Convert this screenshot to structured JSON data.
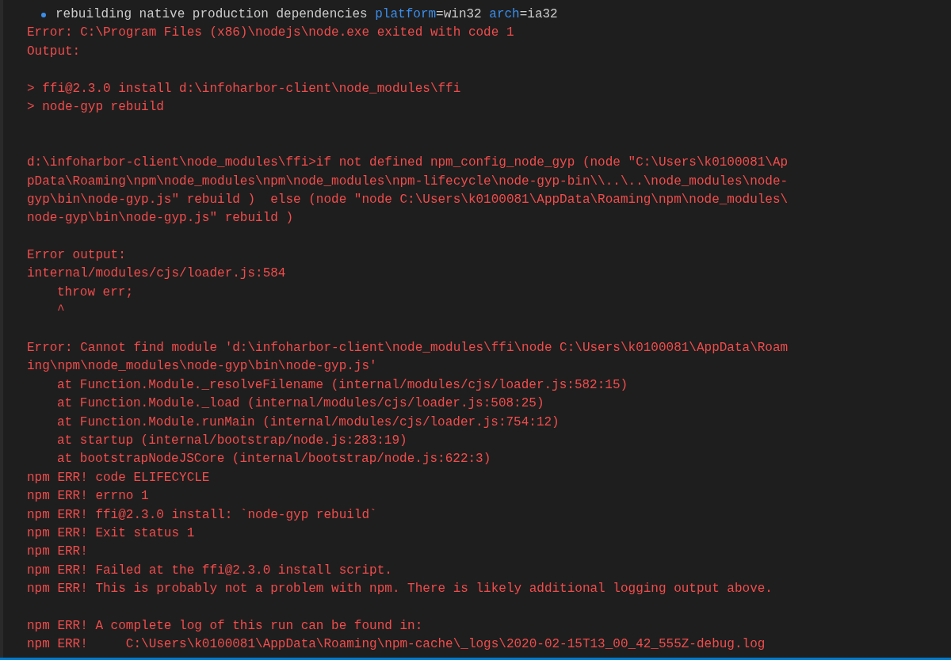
{
  "terminal": {
    "lines": [
      {
        "kind": "info",
        "parts": [
          {
            "kind": "plain",
            "text": "rebuilding native production dependencies "
          },
          {
            "kind": "key",
            "text": "platform"
          },
          {
            "kind": "plain",
            "text": "=win32 "
          },
          {
            "kind": "key",
            "text": "arch"
          },
          {
            "kind": "plain",
            "text": "=ia32"
          }
        ]
      },
      {
        "kind": "error",
        "indented": false,
        "text": "Error: C:\\Program Files (x86)\\nodejs\\node.exe exited with code 1"
      },
      {
        "kind": "error",
        "indented": false,
        "text": "Output:"
      },
      {
        "kind": "blank"
      },
      {
        "kind": "error",
        "indented": false,
        "text": "> ffi@2.3.0 install d:\\infoharbor-client\\node_modules\\ffi"
      },
      {
        "kind": "error",
        "indented": false,
        "text": "> node-gyp rebuild"
      },
      {
        "kind": "blank"
      },
      {
        "kind": "blank"
      },
      {
        "kind": "error",
        "indented": false,
        "text": "d:\\infoharbor-client\\node_modules\\ffi>if not defined npm_config_node_gyp (node \"C:\\Users\\k0100081\\Ap"
      },
      {
        "kind": "error",
        "indented": false,
        "text": "pData\\Roaming\\npm\\node_modules\\npm\\node_modules\\npm-lifecycle\\node-gyp-bin\\\\..\\..\\node_modules\\node-"
      },
      {
        "kind": "error",
        "indented": false,
        "text": "gyp\\bin\\node-gyp.js\" rebuild )  else (node \"node C:\\Users\\k0100081\\AppData\\Roaming\\npm\\node_modules\\"
      },
      {
        "kind": "error",
        "indented": false,
        "text": "node-gyp\\bin\\node-gyp.js\" rebuild )"
      },
      {
        "kind": "blank"
      },
      {
        "kind": "error",
        "indented": false,
        "text": "Error output:"
      },
      {
        "kind": "error",
        "indented": false,
        "text": "internal/modules/cjs/loader.js:584"
      },
      {
        "kind": "error",
        "indented": true,
        "text": "throw err;"
      },
      {
        "kind": "error",
        "indented": true,
        "text": "^"
      },
      {
        "kind": "blank"
      },
      {
        "kind": "error",
        "indented": false,
        "text": "Error: Cannot find module 'd:\\infoharbor-client\\node_modules\\ffi\\node C:\\Users\\k0100081\\AppData\\Roam"
      },
      {
        "kind": "error",
        "indented": false,
        "text": "ing\\npm\\node_modules\\node-gyp\\bin\\node-gyp.js'"
      },
      {
        "kind": "error",
        "indented": true,
        "text": "at Function.Module._resolveFilename (internal/modules/cjs/loader.js:582:15)"
      },
      {
        "kind": "error",
        "indented": true,
        "text": "at Function.Module._load (internal/modules/cjs/loader.js:508:25)"
      },
      {
        "kind": "error",
        "indented": true,
        "text": "at Function.Module.runMain (internal/modules/cjs/loader.js:754:12)"
      },
      {
        "kind": "error",
        "indented": true,
        "text": "at startup (internal/bootstrap/node.js:283:19)"
      },
      {
        "kind": "error",
        "indented": true,
        "text": "at bootstrapNodeJSCore (internal/bootstrap/node.js:622:3)"
      },
      {
        "kind": "error",
        "indented": false,
        "text": "npm ERR! code ELIFECYCLE"
      },
      {
        "kind": "error",
        "indented": false,
        "text": "npm ERR! errno 1"
      },
      {
        "kind": "error",
        "indented": false,
        "text": "npm ERR! ffi@2.3.0 install: `node-gyp rebuild`"
      },
      {
        "kind": "error",
        "indented": false,
        "text": "npm ERR! Exit status 1"
      },
      {
        "kind": "error",
        "indented": false,
        "text": "npm ERR!"
      },
      {
        "kind": "error",
        "indented": false,
        "text": "npm ERR! Failed at the ffi@2.3.0 install script."
      },
      {
        "kind": "error",
        "indented": false,
        "text": "npm ERR! This is probably not a problem with npm. There is likely additional logging output above."
      },
      {
        "kind": "blank"
      },
      {
        "kind": "error",
        "indented": false,
        "text": "npm ERR! A complete log of this run can be found in:"
      },
      {
        "kind": "error",
        "indented": false,
        "text": "npm ERR!     C:\\Users\\k0100081\\AppData\\Roaming\\npm-cache\\_logs\\2020-02-15T13_00_42_555Z-debug.log"
      }
    ]
  }
}
